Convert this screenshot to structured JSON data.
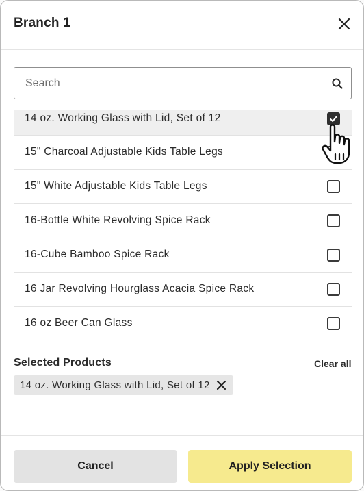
{
  "modal": {
    "title": "Branch 1"
  },
  "search": {
    "placeholder": "Search",
    "value": ""
  },
  "products": [
    {
      "label": "14 oz. Working Glass with Lid, Set of 12",
      "checked": true
    },
    {
      "label": "15\" Charcoal Adjustable Kids Table Legs",
      "checked": false
    },
    {
      "label": "15\" White Adjustable Kids Table Legs",
      "checked": false
    },
    {
      "label": "16-Bottle White Revolving Spice Rack",
      "checked": false
    },
    {
      "label": "16-Cube Bamboo Spice Rack",
      "checked": false
    },
    {
      "label": "16 Jar Revolving Hourglass Acacia Spice Rack",
      "checked": false
    },
    {
      "label": "16 oz Beer Can Glass",
      "checked": false
    }
  ],
  "selected": {
    "title": "Selected Products",
    "clear_label": "Clear all",
    "chips": [
      {
        "label": "14 oz. Working Glass with Lid, Set of 12"
      }
    ]
  },
  "footer": {
    "cancel_label": "Cancel",
    "apply_label": "Apply Selection"
  },
  "colors": {
    "apply_button": "#f6ea8e",
    "cancel_button": "#e3e3e3",
    "highlight_row": "#efefef",
    "chip": "#e6e6e6"
  }
}
